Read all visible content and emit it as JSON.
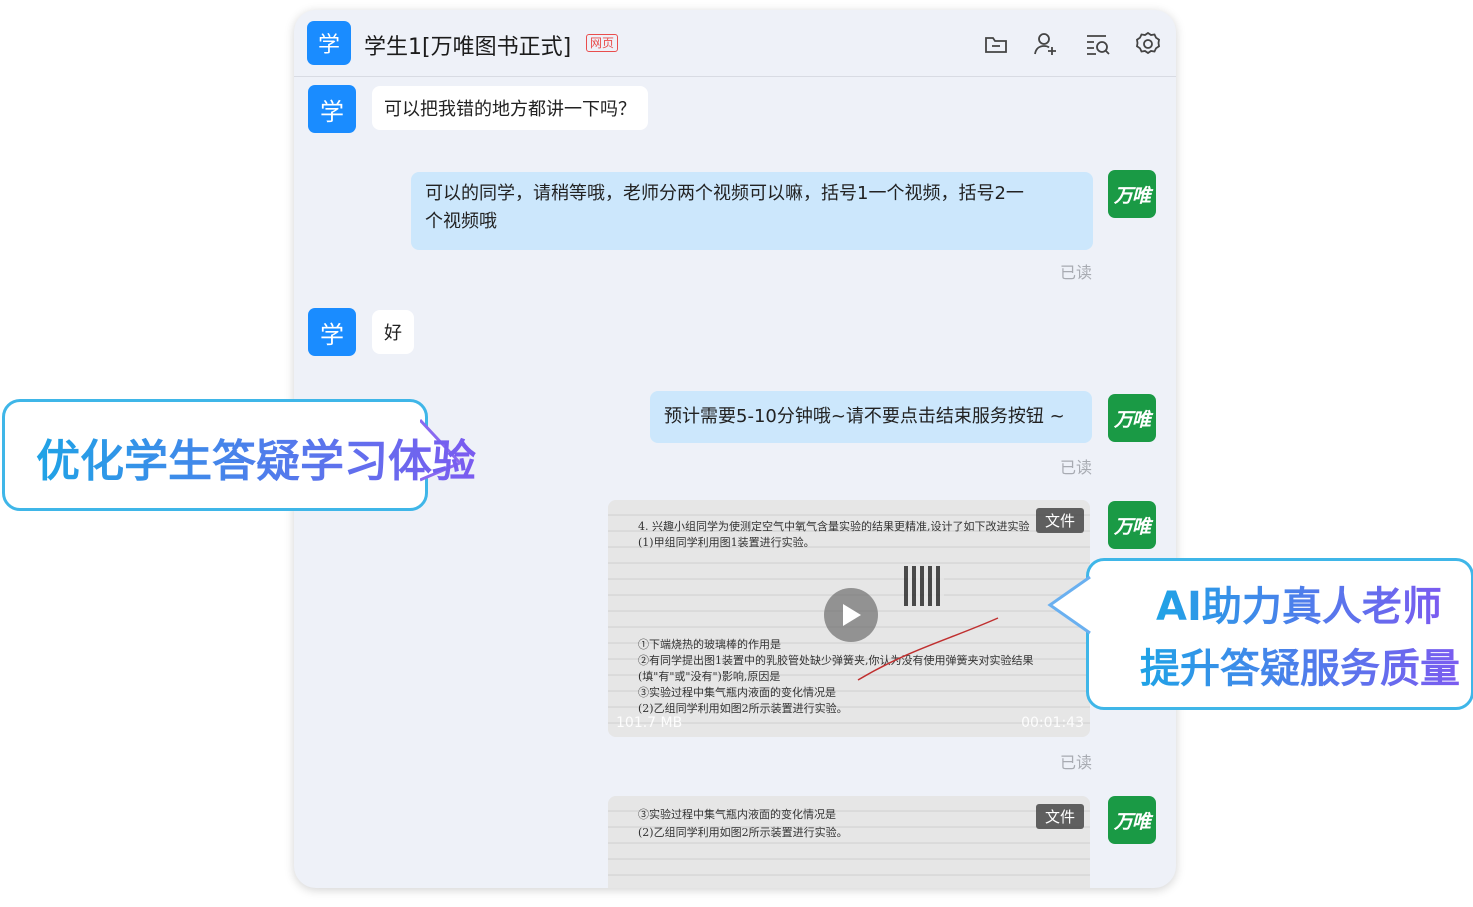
{
  "header": {
    "avatar_char": "学",
    "title": "学生1[万唯图书正式]",
    "badge": "网页",
    "icons": [
      "folder-icon",
      "add-user-icon",
      "search-list-icon",
      "gear-icon"
    ]
  },
  "avatars": {
    "student_char": "学",
    "teacher_logo": "万唯"
  },
  "messages": [
    {
      "from": "student",
      "text": "可以把我错的地方都讲一下吗？"
    },
    {
      "from": "teacher",
      "line1": "可以的同学，请稍等哦，老师分两个视频可以嘛，括号1一个视频，括号2一",
      "line2": "个视频哦",
      "status": "已读"
    },
    {
      "from": "student",
      "text": "好"
    },
    {
      "from": "teacher",
      "text": "预计需要5-10分钟哦~请不要点击结束服务按钮 ~",
      "status": "已读"
    },
    {
      "from": "teacher",
      "type": "video",
      "tag": "文件",
      "size": "101.7 MB",
      "duration": "00:01:43",
      "status": "已读"
    },
    {
      "from": "teacher",
      "type": "video",
      "tag": "文件"
    }
  ],
  "callouts": {
    "left": "优化学生答疑学习体验",
    "right_line1": "AI助力真人老师",
    "right_line2": "提升答疑服务质量"
  },
  "colors": {
    "student_avatar": "#1a8cff",
    "teacher_avatar": "#1a9a45",
    "teacher_bubble": "#cce7fc",
    "chat_bg": "#eef1f8"
  }
}
